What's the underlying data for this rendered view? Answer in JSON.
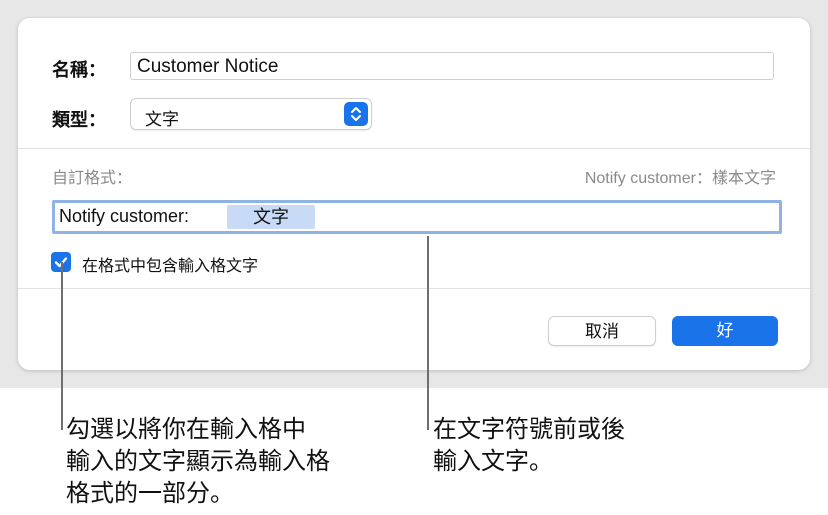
{
  "dialog": {
    "name_label": "名稱：",
    "name_value": "Customer Notice",
    "type_label": "類型：",
    "type_value": "文字",
    "custom_format_label": "自訂格式：",
    "sample_text": "Notify customer：樣本文字",
    "format_prefix": "Notify customer:",
    "format_token": "文字",
    "include_checkbox_label": "在格式中包含輸入格文字",
    "include_checkbox_checked": true,
    "cancel_label": "取消",
    "ok_label": "好"
  },
  "callouts": {
    "left": [
      "勾選以將你在輸入格中",
      "輸入的文字顯示為輸入格",
      "格式的一部分。"
    ],
    "right": [
      "在文字符號前或後",
      "輸入文字。"
    ]
  },
  "colors": {
    "accent": "#1a73e8",
    "token_highlight": "#c7dbf6",
    "focus_ring": "#8fb3e6"
  },
  "icons": {
    "select_stepper": "chevron-up-down-icon",
    "checkbox": "checkmark-icon"
  }
}
